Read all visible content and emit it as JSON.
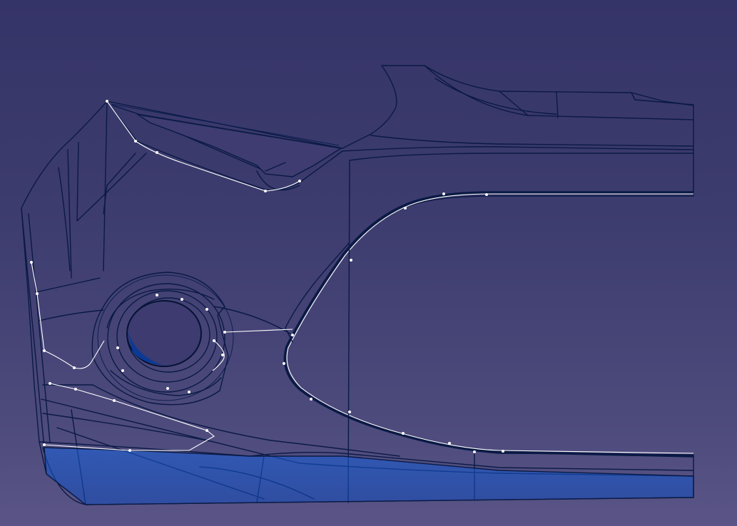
{
  "viewport": {
    "background_top": "#353468",
    "background_bottom": "#5a5586",
    "part_color": "#1a6cf0",
    "highlight_color": "#7de8ff",
    "edge_color": "#0a1a44",
    "wireframe_color": "#ffffff"
  },
  "part": {
    "icon": "bumper-surface-icon",
    "features": [
      "fog-lamp-opening",
      "grille-opening",
      "upper-air-intake",
      "wireframe-curve",
      "control-points"
    ]
  }
}
